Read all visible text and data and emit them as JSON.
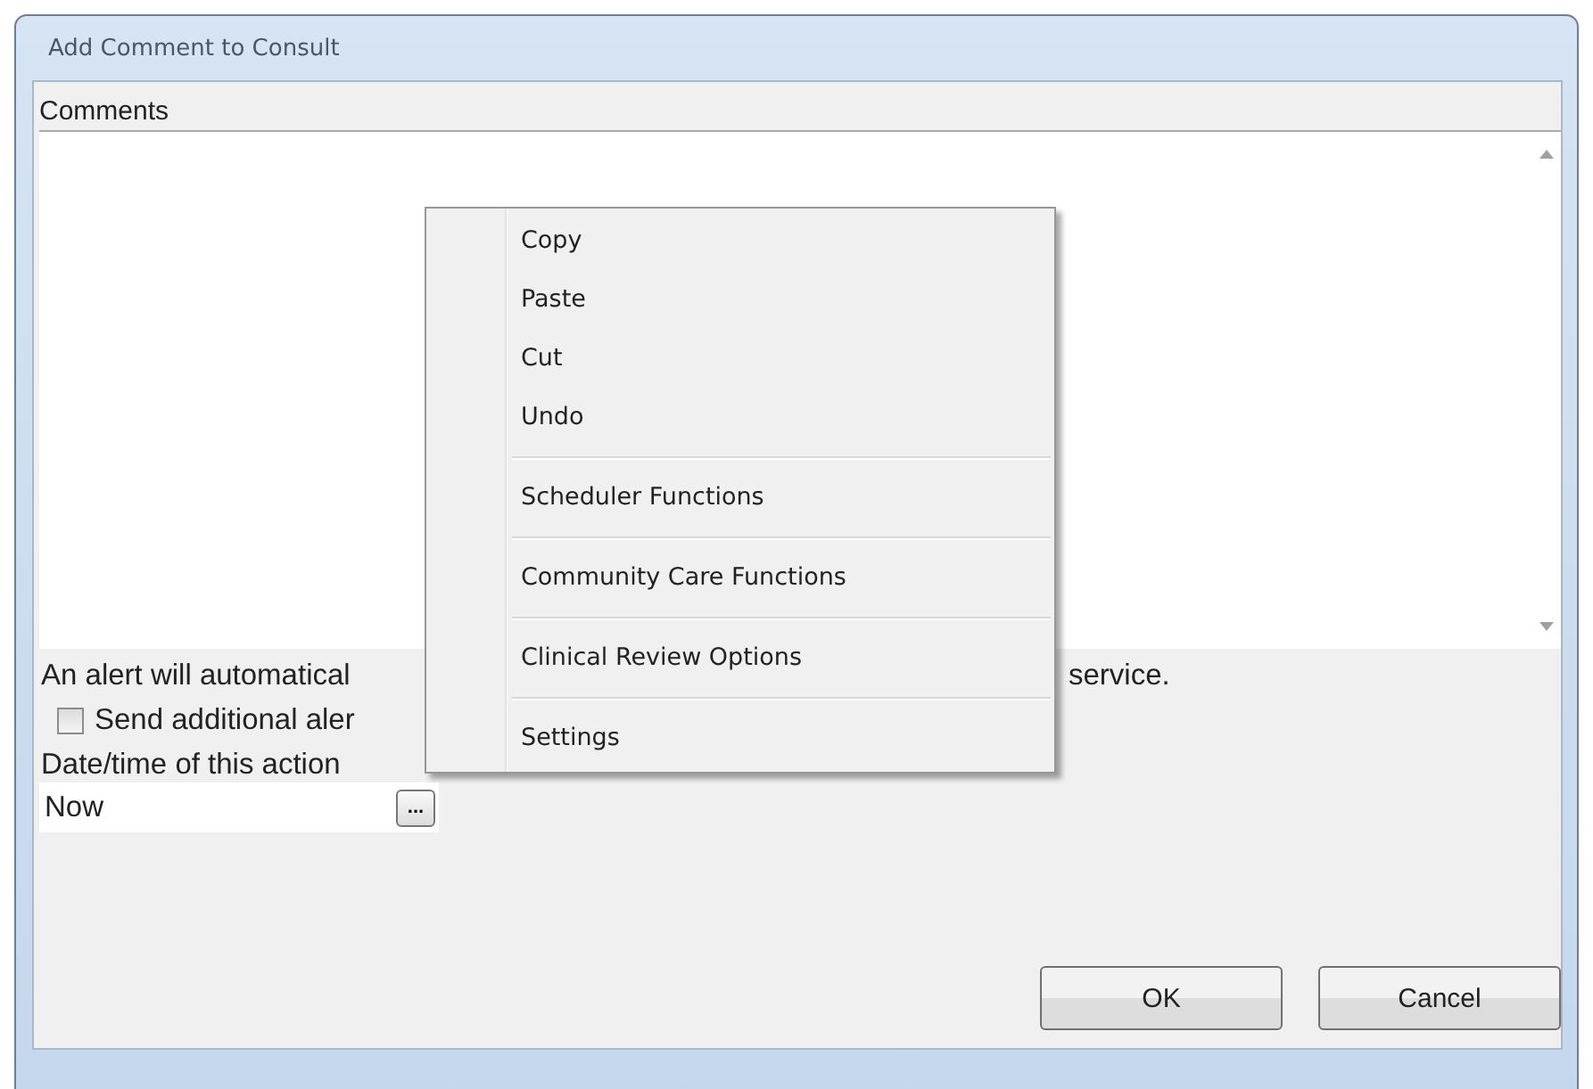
{
  "window": {
    "title": "Add Comment to Consult"
  },
  "comments": {
    "label": "Comments"
  },
  "alert_text": {
    "left": "An alert will automatical",
    "right": "service."
  },
  "additional_alert": {
    "label": "Send additional aler",
    "checked": false
  },
  "datetime": {
    "label": "Date/time of this action",
    "value": "Now",
    "button": "..."
  },
  "buttons": [
    "OK",
    "Cancel"
  ],
  "context_menu": {
    "groups": [
      [
        "Copy",
        "Paste",
        "Cut",
        "Undo"
      ],
      [
        "Scheduler Functions"
      ],
      [
        "Community Care Functions"
      ],
      [
        "Clinical Review Options"
      ],
      [
        "Settings"
      ]
    ]
  }
}
